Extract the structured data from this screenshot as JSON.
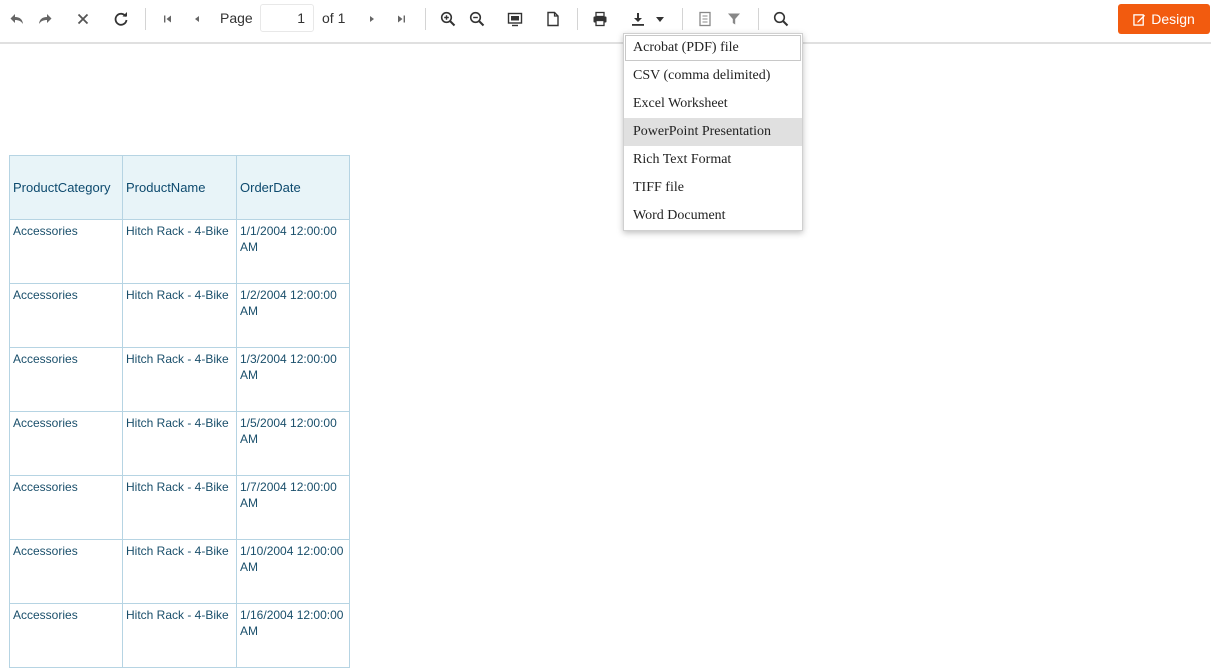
{
  "toolbar": {
    "page_label": "Page",
    "page_value": "1",
    "of_label": "of 1",
    "design_label": "Design",
    "icons": [
      "undo-icon",
      "redo-icon",
      "close-icon",
      "refresh-icon",
      "first-page-icon",
      "prev-page-icon",
      "next-page-icon",
      "last-page-icon",
      "zoom-in-icon",
      "zoom-out-icon",
      "fit-page-icon",
      "page-setup-icon",
      "print-icon",
      "export-icon",
      "chevron-down-icon",
      "document-map-icon",
      "filter-icon",
      "search-icon",
      "edit-icon"
    ],
    "accent": "#f25b0f"
  },
  "export_menu": {
    "items": [
      "Acrobat (PDF) file",
      "CSV (comma delimited)",
      "Excel Worksheet",
      "PowerPoint Presentation",
      "Rich Text Format",
      "TIFF file",
      "Word Document"
    ],
    "highlighted": "PowerPoint Presentation"
  },
  "report": {
    "columns": [
      "ProductCategory",
      "ProductName",
      "OrderDate"
    ],
    "rows": [
      [
        "Accessories",
        "Hitch Rack - 4-Bike",
        "1/1/2004 12:00:00 AM"
      ],
      [
        "Accessories",
        "Hitch Rack - 4-Bike",
        "1/2/2004 12:00:00 AM"
      ],
      [
        "Accessories",
        "Hitch Rack - 4-Bike",
        "1/3/2004 12:00:00 AM"
      ],
      [
        "Accessories",
        "Hitch Rack - 4-Bike",
        "1/5/2004 12:00:00 AM"
      ],
      [
        "Accessories",
        "Hitch Rack - 4-Bike",
        "1/7/2004 12:00:00 AM"
      ],
      [
        "Accessories",
        "Hitch Rack - 4-Bike",
        "1/10/2004 12:00:00 AM"
      ],
      [
        "Accessories",
        "Hitch Rack - 4-Bike",
        "1/16/2004 12:00:00 AM"
      ]
    ],
    "header_bg": "#e8f4f8",
    "border_color": "#b6d4e3"
  }
}
